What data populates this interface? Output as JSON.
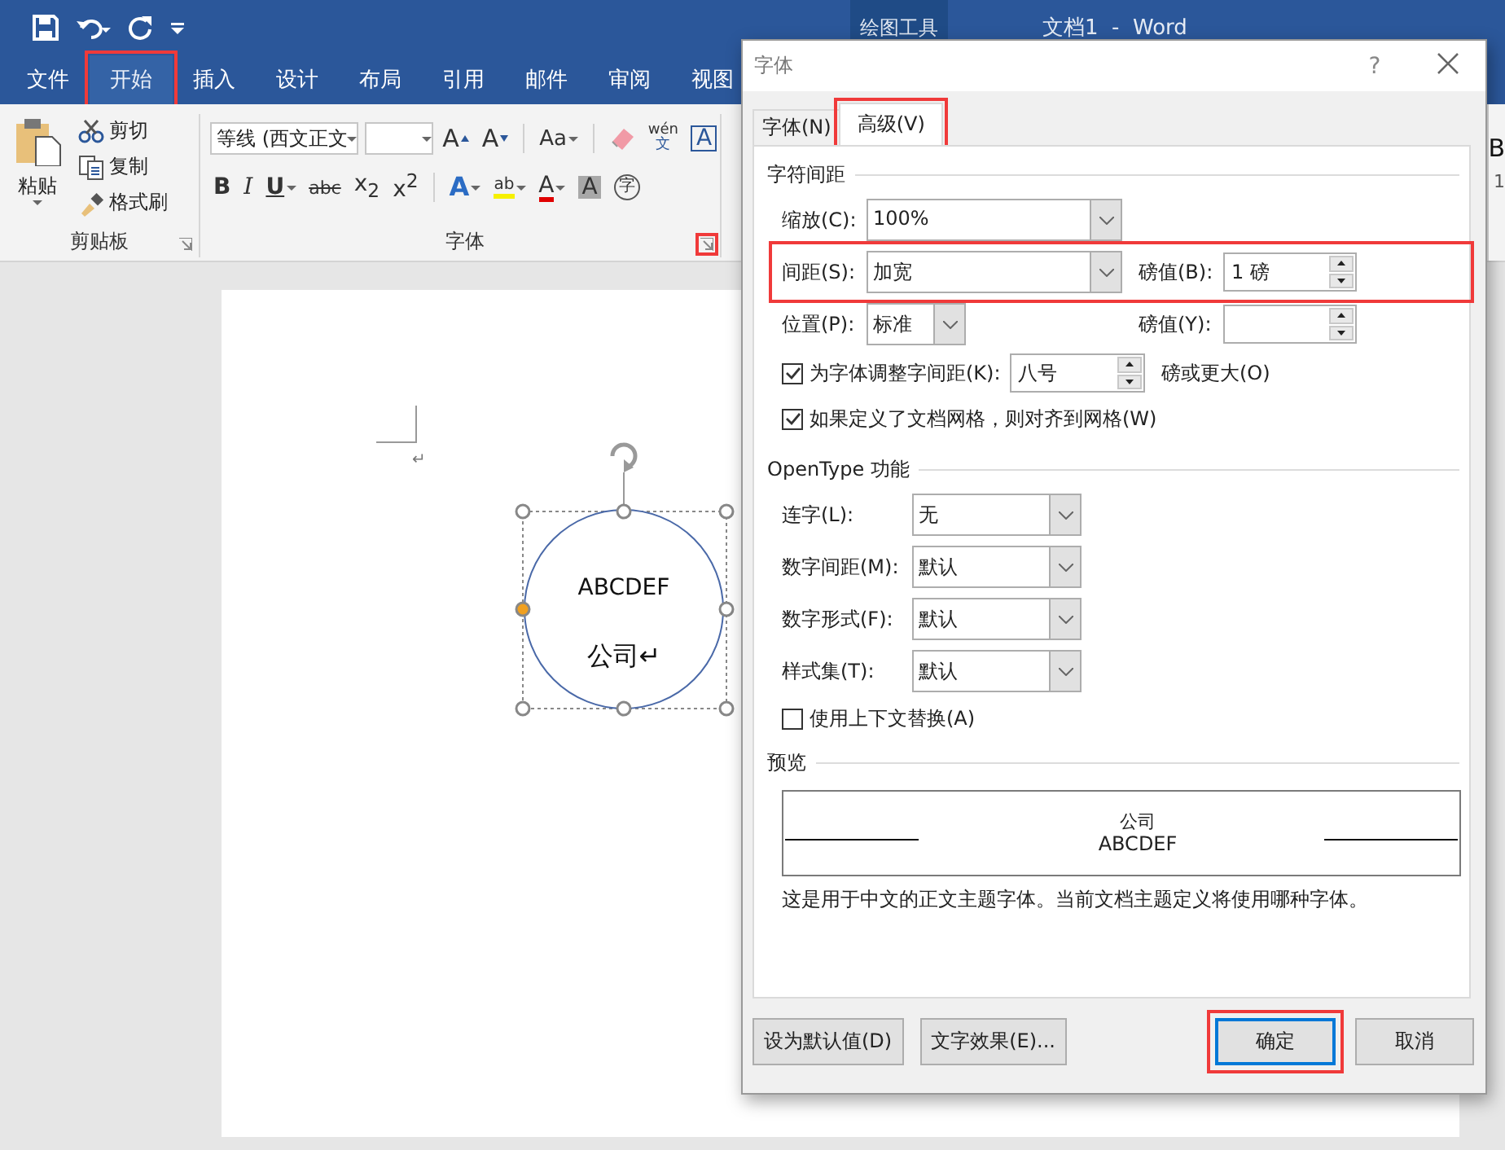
{
  "title_bar": {
    "context_tab": "绘图工具",
    "title": "文档1  -  Word"
  },
  "ribbon_tabs": [
    {
      "label": "文件",
      "selected": false,
      "annotated": false
    },
    {
      "label": "开始",
      "selected": true,
      "annotated": true
    },
    {
      "label": "插入",
      "selected": false,
      "annotated": false
    },
    {
      "label": "设计",
      "selected": false,
      "annotated": false
    },
    {
      "label": "布局",
      "selected": false,
      "annotated": false
    },
    {
      "label": "引用",
      "selected": false,
      "annotated": false
    },
    {
      "label": "邮件",
      "selected": false,
      "annotated": false
    },
    {
      "label": "审阅",
      "selected": false,
      "annotated": false
    },
    {
      "label": "视图",
      "selected": false,
      "annotated": false
    }
  ],
  "clipboard_group": {
    "paste": "粘贴",
    "actions": [
      {
        "kind": "cut",
        "label": "剪切"
      },
      {
        "kind": "copy",
        "label": "复制"
      },
      {
        "kind": "painter",
        "label": "格式刷"
      }
    ],
    "label": "剪贴板"
  },
  "font_group": {
    "font_name": "等线 (西文正文",
    "label": "字体",
    "launcher_annotated": true,
    "row1": [
      {
        "kind": "grow",
        "glyph": "A"
      },
      {
        "kind": "shrink",
        "glyph": "A"
      },
      {
        "kind": "case",
        "glyph": "Aa"
      },
      {
        "kind": "clear"
      },
      {
        "kind": "phonetic",
        "glyph": "wén",
        "sub": "文"
      },
      {
        "kind": "border",
        "glyph": "A"
      }
    ],
    "row2": [
      {
        "kind": "bold",
        "glyph": "B"
      },
      {
        "kind": "italic",
        "glyph": "I"
      },
      {
        "kind": "underline",
        "glyph": "U"
      },
      {
        "kind": "strike",
        "glyph": "abc"
      },
      {
        "kind": "sub",
        "glyph": "x$_{2}$"
      },
      {
        "kind": "sup",
        "glyph": "x$^{2}$"
      },
      {
        "kind": "effects",
        "glyph": "A"
      },
      {
        "kind": "highlight",
        "glyph": "ab"
      },
      {
        "kind": "color",
        "glyph": "A"
      },
      {
        "kind": "shading",
        "glyph": "A"
      },
      {
        "kind": "enclose",
        "glyph": "字"
      }
    ]
  },
  "ribbon_peek": [
    "B",
    "1"
  ],
  "document": {
    "paragraph_mark": "↵",
    "shape_lines": [
      "ABCDEF",
      "公司↵"
    ]
  },
  "dialog": {
    "title": "字体",
    "help": "?",
    "tabs": [
      {
        "label": "字体(N)",
        "selected": false,
        "annotated": false
      },
      {
        "label": "高级(V)",
        "selected": true,
        "annotated": true
      }
    ],
    "spacing_section": {
      "title": "字符间距",
      "scale": {
        "label": "缩放(C):",
        "value": "100%"
      },
      "spacing": {
        "label": "间距(S):",
        "value": "加宽",
        "annotated": true
      },
      "spacing_by": {
        "label": "磅值(B):",
        "value": "1 磅"
      },
      "position": {
        "label": "位置(P):",
        "value": "标准"
      },
      "position_by": {
        "label": "磅值(Y):"
      },
      "kerning": {
        "label": "为字体调整字间距(K):",
        "checked": true,
        "value": "八号",
        "suffix": "磅或更大(O)"
      },
      "snap": {
        "label": "如果定义了文档网格，则对齐到网格(W)",
        "checked": true
      }
    },
    "opentype_section": {
      "title": "OpenType 功能",
      "selects": [
        {
          "label": "连字(L):",
          "value": "无"
        },
        {
          "label": "数字间距(M):",
          "value": "默认"
        },
        {
          "label": "数字形式(F):",
          "value": "默认"
        },
        {
          "label": "样式集(T):",
          "value": "默认"
        }
      ],
      "contextual": {
        "label": "使用上下文替换(A)",
        "checked": false
      }
    },
    "preview": {
      "title": "预览",
      "sample": "ABCDEF",
      "overlap": "公司",
      "note": "这是用于中文的正文主题字体。当前文档主题定义将使用哪种字体。"
    },
    "buttons": [
      {
        "label": "设为默认值(D)",
        "primary": false,
        "annotated": false
      },
      {
        "label": "文字效果(E)...",
        "primary": false,
        "annotated": false
      },
      {
        "label": "确定",
        "primary": true,
        "annotated": true
      },
      {
        "label": "取消",
        "primary": false,
        "annotated": false
      }
    ]
  }
}
